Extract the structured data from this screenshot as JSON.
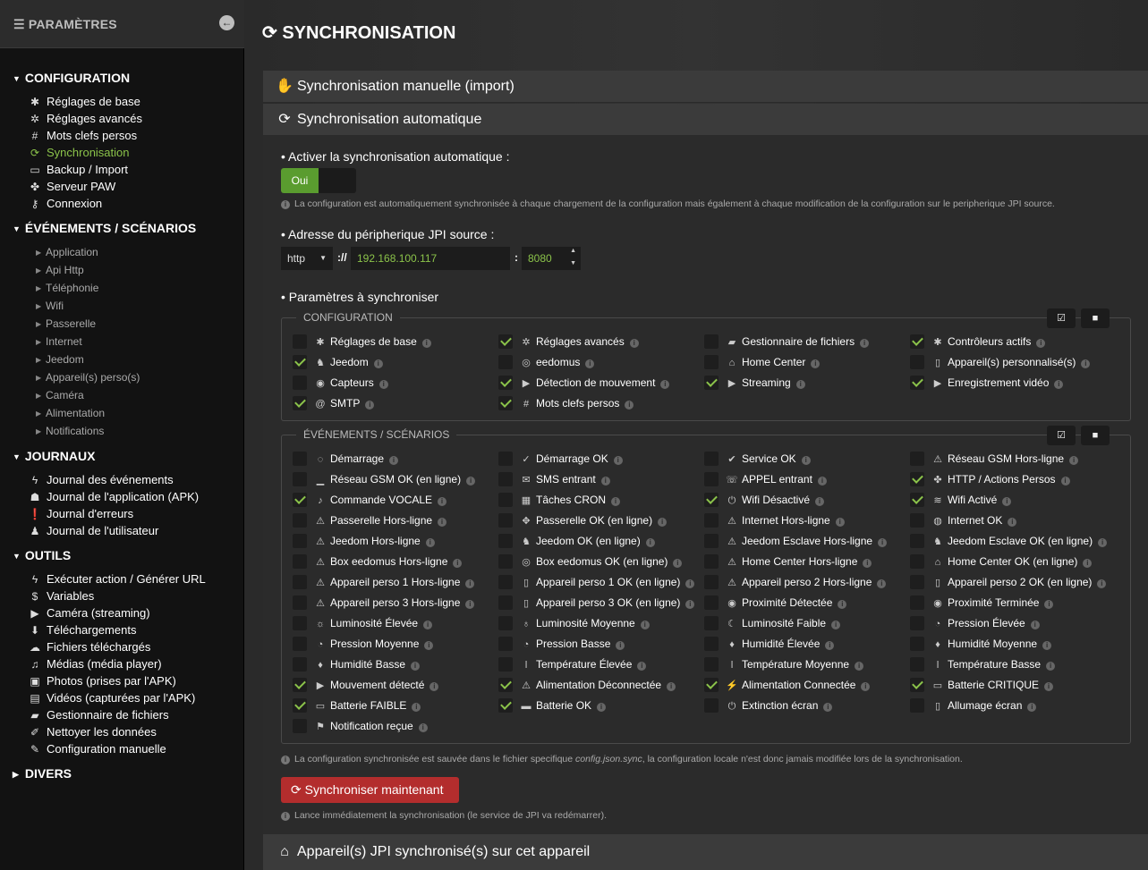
{
  "sidebar": {
    "title": "PARAMÈTRES",
    "sections": {
      "configuration": {
        "label": "CONFIGURATION",
        "items": [
          {
            "label": "Réglages de base",
            "icon": "gear-icon",
            "glyph": "✱"
          },
          {
            "label": "Réglages avancés",
            "icon": "gears-icon",
            "glyph": "✲"
          },
          {
            "label": "Mots clefs persos",
            "icon": "hashtag-icon",
            "glyph": "#"
          },
          {
            "label": "Synchronisation",
            "icon": "sync-icon",
            "glyph": "⟳"
          },
          {
            "label": "Backup / Import",
            "icon": "hdd-icon",
            "glyph": "▭"
          },
          {
            "label": "Serveur PAW",
            "icon": "paw-icon",
            "glyph": "✤"
          },
          {
            "label": "Connexion",
            "icon": "key-icon",
            "glyph": "⚷"
          }
        ]
      },
      "events": {
        "label": "ÉVÉNEMENTS / SCÉNARIOS",
        "items": [
          "Application",
          "Api Http",
          "Téléphonie",
          "Wifi",
          "Passerelle",
          "Internet",
          "Jeedom",
          "Appareil(s) perso(s)",
          "Caméra",
          "Alimentation",
          "Notifications"
        ]
      },
      "journaux": {
        "label": "JOURNAUX",
        "items": [
          {
            "label": "Journal des événements",
            "icon": "bolt-icon",
            "glyph": "ϟ"
          },
          {
            "label": "Journal de l'application (APK)",
            "icon": "android-icon",
            "glyph": "☗"
          },
          {
            "label": "Journal d'erreurs",
            "icon": "exclamation-circle-icon",
            "glyph": "❗"
          },
          {
            "label": "Journal de l'utilisateur",
            "icon": "user-icon",
            "glyph": "♟"
          }
        ]
      },
      "outils": {
        "label": "OUTILS",
        "items": [
          {
            "label": "Exécuter action / Générer URL",
            "icon": "bolt-icon",
            "glyph": "ϟ"
          },
          {
            "label": "Variables",
            "icon": "dollar-icon",
            "glyph": "$"
          },
          {
            "label": "Caméra (streaming)",
            "icon": "video-icon",
            "glyph": "▶"
          },
          {
            "label": "Téléchargements",
            "icon": "download-icon",
            "glyph": "⬇"
          },
          {
            "label": "Fichiers téléchargés",
            "icon": "cloud-download-icon",
            "glyph": "☁"
          },
          {
            "label": "Médias (média player)",
            "icon": "music-icon",
            "glyph": "♫"
          },
          {
            "label": "Photos (prises par l'APK)",
            "icon": "image-icon",
            "glyph": "▣"
          },
          {
            "label": "Vidéos (capturées par l'APK)",
            "icon": "video-file-icon",
            "glyph": "▤"
          },
          {
            "label": "Gestionnaire de fichiers",
            "icon": "folder-open-icon",
            "glyph": "▰"
          },
          {
            "label": "Nettoyer les données",
            "icon": "eraser-icon",
            "glyph": "✐"
          },
          {
            "label": "Configuration manuelle",
            "icon": "edit-icon",
            "glyph": "✎"
          }
        ]
      },
      "divers": {
        "label": "DIVERS"
      }
    }
  },
  "page": {
    "title": "SYNCHRONISATION"
  },
  "panels": {
    "manual": "Synchronisation manuelle (import)",
    "auto": "Synchronisation automatique",
    "devices": "Appareil(s) JPI synchronisé(s) sur cet appareil"
  },
  "auto": {
    "enable_label": "• Activer la synchronisation automatique :",
    "toggle_on": "Oui",
    "enable_help": "La configuration est automatiquement synchronisée à chaque chargement de la configuration mais également à chaque modification de la configuration sur le peripherique JPI source.",
    "address_label": "• Adresse du péripherique JPI source :",
    "protocol": "http",
    "sep": "://",
    "host": "192.168.100.117",
    "colon": ":",
    "port": "8080",
    "params_label": "• Paramètres à synchroniser",
    "fs_config": "CONFIGURATION",
    "fs_events": "ÉVÉNEMENTS / SCÉNARIOS",
    "config_items": [
      {
        "label": "Réglages de base",
        "checked": false,
        "icon": "gear-icon",
        "g": "✱"
      },
      {
        "label": "Réglages avancés",
        "checked": true,
        "icon": "gears-icon",
        "g": "✲"
      },
      {
        "label": "Gestionnaire de fichiers",
        "checked": false,
        "icon": "folder-open-icon",
        "g": "▰"
      },
      {
        "label": "Contrôleurs actifs",
        "checked": true,
        "icon": "gear-icon",
        "g": "✱"
      },
      {
        "label": "Jeedom",
        "checked": true,
        "icon": "jeedom-icon",
        "g": "♞"
      },
      {
        "label": "eedomus",
        "checked": false,
        "icon": "eedomus-icon",
        "g": "◎"
      },
      {
        "label": "Home Center",
        "checked": false,
        "icon": "home-center-icon",
        "g": "⌂"
      },
      {
        "label": "Appareil(s) personnalisé(s)",
        "checked": false,
        "icon": "device-icon",
        "g": "▯"
      },
      {
        "label": "Capteurs",
        "checked": false,
        "icon": "eye-icon",
        "g": "◉"
      },
      {
        "label": "Détection de mouvement",
        "checked": true,
        "icon": "video-icon",
        "g": "▶"
      },
      {
        "label": "Streaming",
        "checked": true,
        "icon": "video-icon",
        "g": "▶"
      },
      {
        "label": "Enregistrement vidéo",
        "checked": true,
        "icon": "video-icon",
        "g": "▶"
      },
      {
        "label": "SMTP",
        "checked": true,
        "icon": "at-icon",
        "g": "@"
      },
      {
        "label": "Mots clefs persos",
        "checked": true,
        "icon": "hashtag-icon",
        "g": "#"
      }
    ],
    "event_items": [
      {
        "label": "Démarrage",
        "checked": false,
        "icon": "circle-notch-icon",
        "g": "◌"
      },
      {
        "label": "Démarrage OK",
        "checked": false,
        "icon": "check-icon",
        "g": "✓"
      },
      {
        "label": "Service OK",
        "checked": false,
        "icon": "check-circle-icon",
        "g": "✔"
      },
      {
        "label": "Réseau GSM Hors-ligne",
        "checked": false,
        "icon": "warning-icon",
        "g": "⚠"
      },
      {
        "label": "Réseau GSM OK (en ligne)",
        "checked": false,
        "icon": "signal-icon",
        "g": "▁"
      },
      {
        "label": "SMS entrant",
        "checked": false,
        "icon": "comment-icon",
        "g": "✉"
      },
      {
        "label": "APPEL entrant",
        "checked": false,
        "icon": "phone-icon",
        "g": "☏"
      },
      {
        "label": "HTTP / Actions Persos",
        "checked": true,
        "icon": "paw-icon",
        "g": "✤"
      },
      {
        "label": "Commande VOCALE",
        "checked": true,
        "icon": "microphone-icon",
        "g": "♪"
      },
      {
        "label": "Tâches CRON",
        "checked": false,
        "icon": "calendar-icon",
        "g": "▦"
      },
      {
        "label": "Wifi Désactivé",
        "checked": true,
        "icon": "power-icon",
        "g": "⏻"
      },
      {
        "label": "Wifi Activé",
        "checked": true,
        "icon": "wifi-icon",
        "g": "≋"
      },
      {
        "label": "Passerelle Hors-ligne",
        "checked": false,
        "icon": "warning-icon",
        "g": "⚠"
      },
      {
        "label": "Passerelle OK (en ligne)",
        "checked": false,
        "icon": "expand-icon",
        "g": "✥"
      },
      {
        "label": "Internet Hors-ligne",
        "checked": false,
        "icon": "warning-icon",
        "g": "⚠"
      },
      {
        "label": "Internet OK",
        "checked": false,
        "icon": "globe-icon",
        "g": "◍"
      },
      {
        "label": "Jeedom Hors-ligne",
        "checked": false,
        "icon": "warning-icon",
        "g": "⚠"
      },
      {
        "label": "Jeedom OK (en ligne)",
        "checked": false,
        "icon": "jeedom-icon",
        "g": "♞"
      },
      {
        "label": "Jeedom Esclave Hors-ligne",
        "checked": false,
        "icon": "warning-icon",
        "g": "⚠"
      },
      {
        "label": "Jeedom Esclave OK (en ligne)",
        "checked": false,
        "icon": "jeedom-icon",
        "g": "♞"
      },
      {
        "label": "Box eedomus Hors-ligne",
        "checked": false,
        "icon": "warning-icon",
        "g": "⚠"
      },
      {
        "label": "Box eedomus OK (en ligne)",
        "checked": false,
        "icon": "eedomus-icon",
        "g": "◎"
      },
      {
        "label": "Home Center Hors-ligne",
        "checked": false,
        "icon": "warning-icon",
        "g": "⚠"
      },
      {
        "label": "Home Center OK (en ligne)",
        "checked": false,
        "icon": "home-center-icon",
        "g": "⌂"
      },
      {
        "label": "Appareil perso 1 Hors-ligne",
        "checked": false,
        "icon": "warning-icon",
        "g": "⚠"
      },
      {
        "label": "Appareil perso 1 OK (en ligne)",
        "checked": false,
        "icon": "device-icon",
        "g": "▯"
      },
      {
        "label": "Appareil perso 2 Hors-ligne",
        "checked": false,
        "icon": "warning-icon",
        "g": "⚠"
      },
      {
        "label": "Appareil perso 2 OK (en ligne)",
        "checked": false,
        "icon": "device-icon",
        "g": "▯"
      },
      {
        "label": "Appareil perso 3 Hors-ligne",
        "checked": false,
        "icon": "warning-icon",
        "g": "⚠"
      },
      {
        "label": "Appareil perso 3 OK (en ligne)",
        "checked": false,
        "icon": "device-icon",
        "g": "▯"
      },
      {
        "label": "Proximité Détectée",
        "checked": false,
        "icon": "eye-slash-icon",
        "g": "◉"
      },
      {
        "label": "Proximité Terminée",
        "checked": false,
        "icon": "eye-icon",
        "g": "◉"
      },
      {
        "label": "Luminosité Élevée",
        "checked": false,
        "icon": "sun-icon",
        "g": "☼"
      },
      {
        "label": "Luminosité Moyenne",
        "checked": false,
        "icon": "lightbulb-icon",
        "g": "♁"
      },
      {
        "label": "Luminosité Faible",
        "checked": false,
        "icon": "moon-icon",
        "g": "☾"
      },
      {
        "label": "Pression Élevée",
        "checked": false,
        "icon": "tachometer-icon",
        "g": "◔"
      },
      {
        "label": "Pression Moyenne",
        "checked": false,
        "icon": "tachometer-icon",
        "g": "◔"
      },
      {
        "label": "Pression Basse",
        "checked": false,
        "icon": "tachometer-icon",
        "g": "◔"
      },
      {
        "label": "Humidité Élevée",
        "checked": false,
        "icon": "tint-icon",
        "g": "♦"
      },
      {
        "label": "Humidité Moyenne",
        "checked": false,
        "icon": "tint-icon",
        "g": "♦"
      },
      {
        "label": "Humidité Basse",
        "checked": false,
        "icon": "tint-icon",
        "g": "♦"
      },
      {
        "label": "Température Élevée",
        "checked": false,
        "icon": "thermometer-icon",
        "g": "ǀ"
      },
      {
        "label": "Température Moyenne",
        "checked": false,
        "icon": "thermometer-icon",
        "g": "ǀ"
      },
      {
        "label": "Température Basse",
        "checked": false,
        "icon": "thermometer-icon",
        "g": "ǀ"
      },
      {
        "label": "Mouvement détecté",
        "checked": true,
        "icon": "video-icon",
        "g": "▶"
      },
      {
        "label": "Alimentation Déconnectée",
        "checked": true,
        "icon": "warning-icon",
        "g": "⚠"
      },
      {
        "label": "Alimentation Connectée",
        "checked": true,
        "icon": "plug-icon",
        "g": "⚡"
      },
      {
        "label": "Batterie CRITIQUE",
        "checked": true,
        "icon": "battery-empty-icon",
        "g": "▭"
      },
      {
        "label": "Batterie FAIBLE",
        "checked": true,
        "icon": "battery-low-icon",
        "g": "▭"
      },
      {
        "label": "Batterie OK",
        "checked": true,
        "icon": "battery-full-icon",
        "g": "▬"
      },
      {
        "label": "Extinction écran",
        "checked": false,
        "icon": "power-icon",
        "g": "⏻"
      },
      {
        "label": "Allumage écran",
        "checked": false,
        "icon": "mobile-icon",
        "g": "▯"
      },
      {
        "label": "Notification reçue",
        "checked": false,
        "icon": "flag-icon",
        "g": "⚑"
      }
    ],
    "save_help_a": "La configuration synchronisée est sauvée dans le fichier specifique ",
    "save_help_file": "config.json.sync",
    "save_help_b": ", la configuration locale n'est donc jamais modifiée lors de la synchronisation.",
    "sync_button": "Synchroniser maintenant",
    "sync_help": "Lance immédiatement la synchronisation (le service de JPI va redémarrer)."
  },
  "colors": {
    "accent": "#8bc34a",
    "danger": "#b32d2d",
    "toggle_on": "#5a9c2f"
  }
}
